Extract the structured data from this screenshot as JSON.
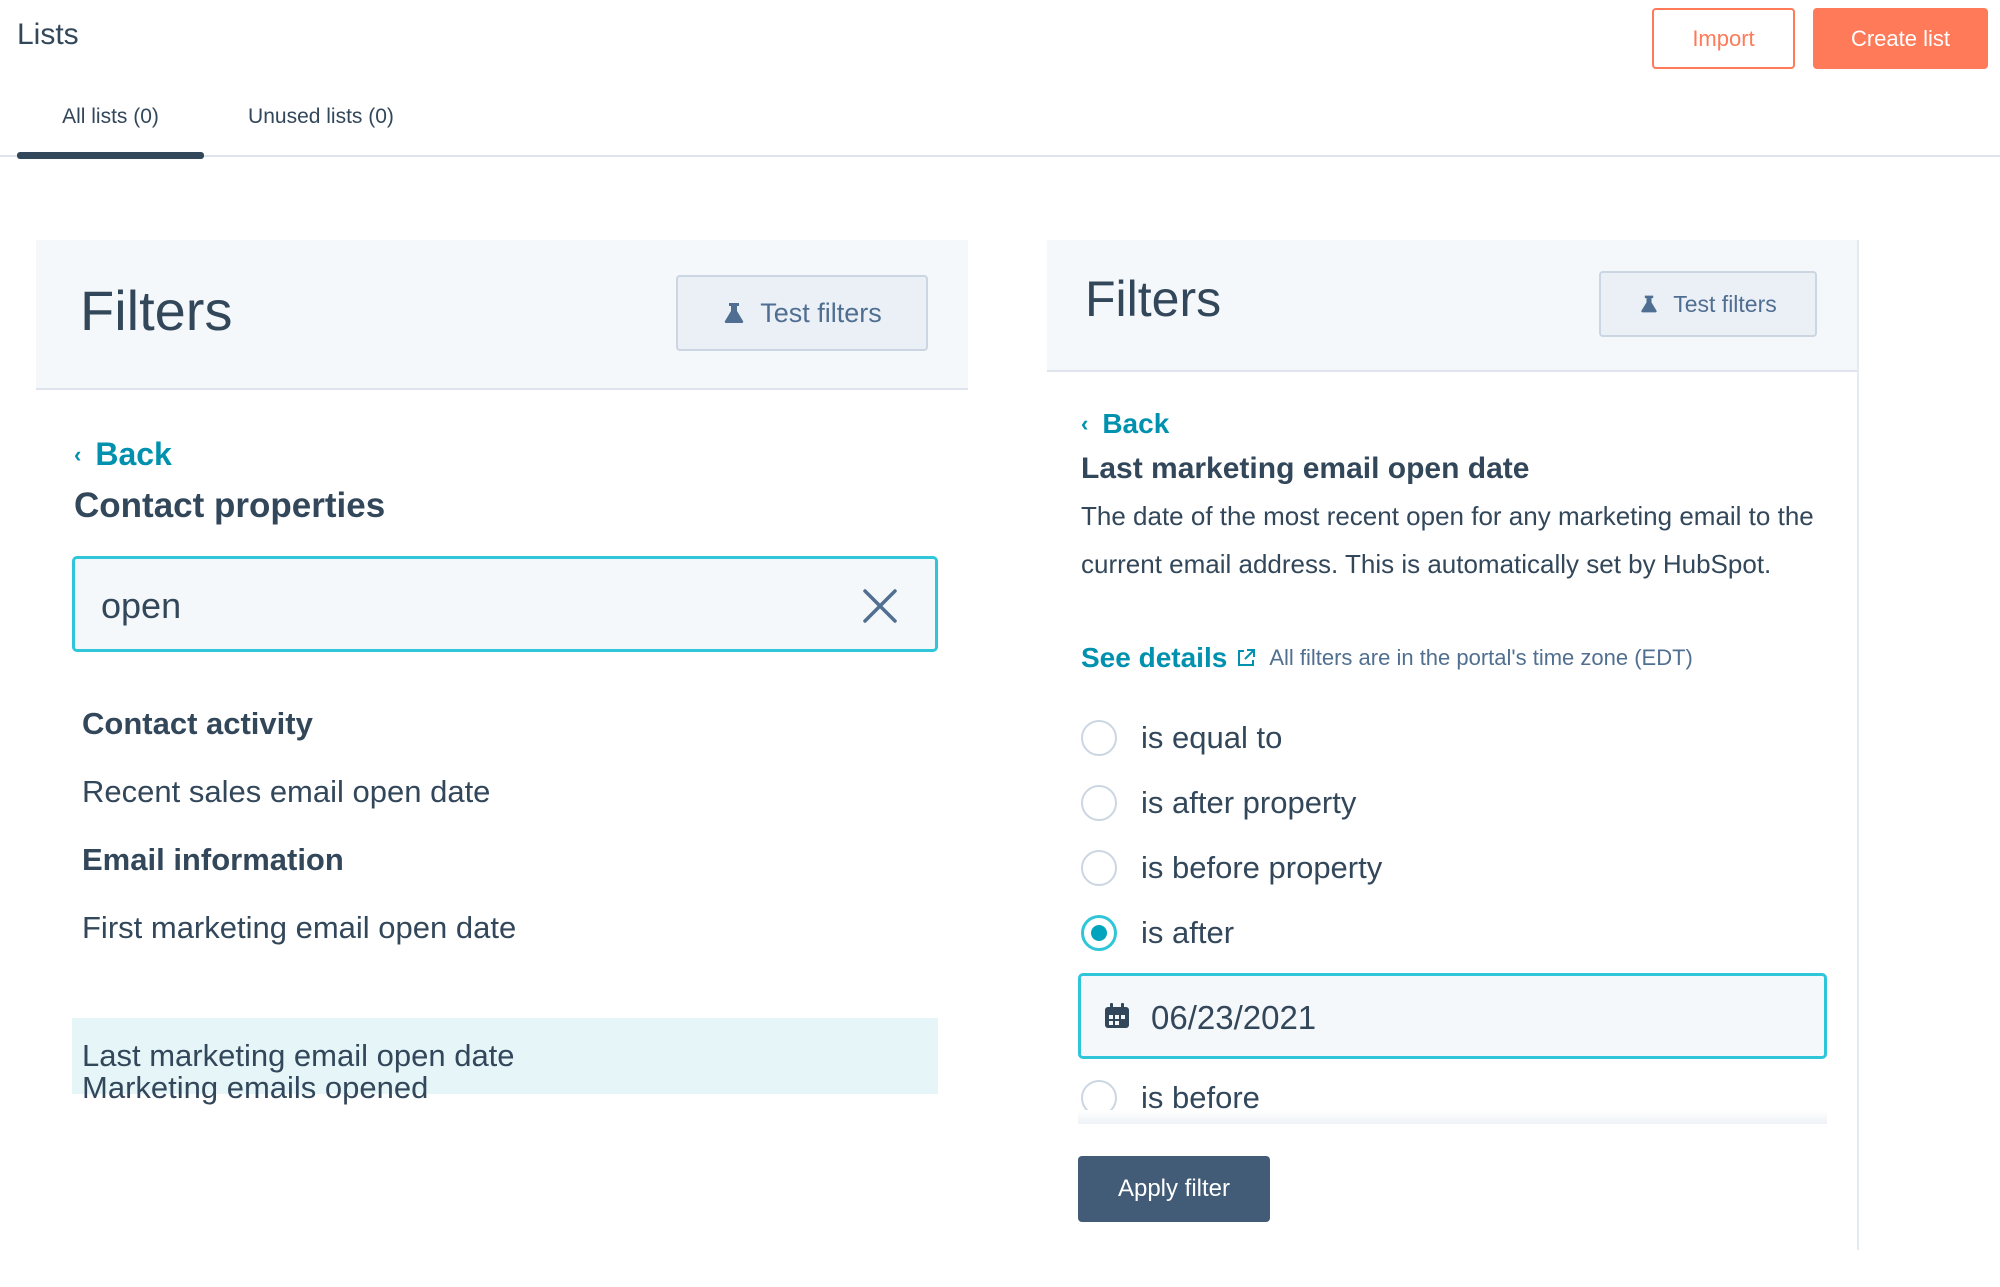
{
  "header": {
    "title": "Lists",
    "import_label": "Import",
    "create_label": "Create list"
  },
  "tabs": [
    {
      "label": "All lists (0)",
      "active": true
    },
    {
      "label": "Unused lists (0)",
      "active": false
    }
  ],
  "colors": {
    "accent": "#ff7a59",
    "link": "#0091ae",
    "focus": "#2fc6d9",
    "primary_button": "#425b76",
    "selected_row": "#e5f5f8"
  },
  "left_panel": {
    "title": "Filters",
    "test_label": "Test filters",
    "back_label": "Back",
    "section_title": "Contact properties",
    "search_value": "open",
    "groups": [
      {
        "label": "Contact activity",
        "items": [
          "Recent sales email open date"
        ]
      },
      {
        "label": "Email information",
        "items": [
          "First marketing email open date",
          "Last marketing email open date",
          "Marketing emails opened"
        ]
      }
    ],
    "selected_item": "Last marketing email open date"
  },
  "right_panel": {
    "title": "Filters",
    "test_label": "Test filters",
    "back_label": "Back",
    "property_title": "Last marketing email open date",
    "description": "The date of the most recent open for any marketing email to the current email address. This is automatically set by HubSpot.",
    "see_details": "See details",
    "timezone_note": "All filters are in the portal's time zone (EDT)",
    "options": [
      "is equal to",
      "is after property",
      "is before property",
      "is after",
      "is before"
    ],
    "selected_option": "is after",
    "date_value": "06/23/2021",
    "apply_label": "Apply filter"
  },
  "icons": [
    "flask-icon",
    "chevron-left-icon",
    "close-icon",
    "external-link-icon",
    "calendar-icon"
  ]
}
